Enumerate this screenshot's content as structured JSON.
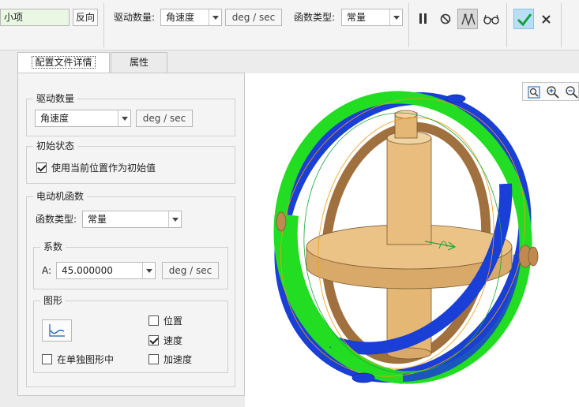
{
  "ribbon": {
    "ref_value": "小项",
    "flip_button": "反向",
    "drive_quantity_label": "驱动数量:",
    "drive_quantity_value": "角速度",
    "drive_unit": "deg / sec",
    "function_type_label": "函数类型:",
    "function_type_value": "常量",
    "pause_icon": "pause-icon",
    "no_icon": "no-icon",
    "mechanism_icon": "mechanism-icon",
    "glasses_icon": "glasses-icon",
    "ok_icon": "checkmark-icon",
    "close_icon": "close-icon"
  },
  "tabs": [
    {
      "label": "配置文件详情",
      "active": true
    },
    {
      "label": "属性",
      "active": false
    }
  ],
  "panel": {
    "drive_quantity": {
      "title": "驱动数量",
      "value": "角速度",
      "unit": "deg / sec"
    },
    "initial_state": {
      "title": "初始状态",
      "checkbox_label": "使用当前位置作为初始值",
      "checked": true
    },
    "motor_function": {
      "title": "电动机函数",
      "function_type_label": "函数类型:",
      "function_type_value": "常量",
      "coefficients": {
        "title": "系数",
        "a_label": "A:",
        "a_value": "45.000000",
        "a_unit": "deg / sec"
      },
      "graph": {
        "title": "图形",
        "graph_icon": "graph-icon",
        "position_label": "位置",
        "position_checked": false,
        "velocity_label": "速度",
        "velocity_checked": true,
        "acceleration_label": "加速度",
        "acceleration_checked": false,
        "separate_label": "在单独图形中",
        "separate_checked": false
      }
    }
  },
  "viewport": {
    "colors": {
      "green": "#22dd22",
      "blue": "#1a3fd6",
      "bronze": "#a0703f",
      "beige": "#ecc387"
    },
    "toolbar": [
      "zoom-fit-icon",
      "zoom-in-icon",
      "zoom-out-icon"
    ]
  }
}
